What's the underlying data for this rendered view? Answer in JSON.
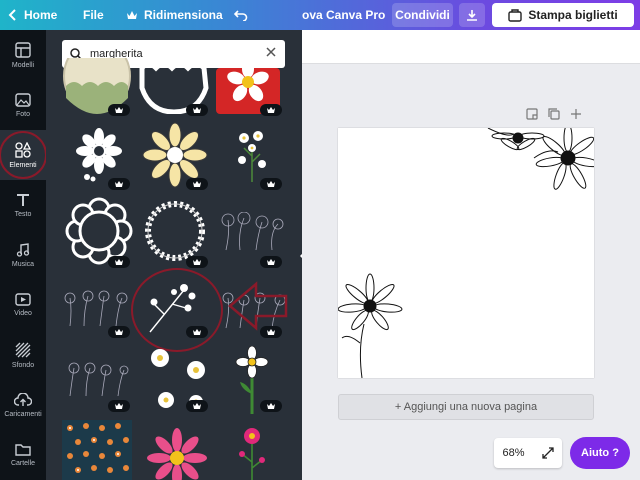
{
  "topbar": {
    "home_label": "Home",
    "file_label": "File",
    "resize_label": "Ridimensiona",
    "pro_label": "ova Canva Pro",
    "share_label": "Condividi",
    "print_label": "Stampa biglietti"
  },
  "rail": {
    "items": [
      {
        "label": "Modelli",
        "icon": "template-icon"
      },
      {
        "label": "Foto",
        "icon": "photo-icon"
      },
      {
        "label": "Elementi",
        "icon": "elements-icon"
      },
      {
        "label": "Testo",
        "icon": "text-icon"
      },
      {
        "label": "Musica",
        "icon": "music-icon"
      },
      {
        "label": "Video",
        "icon": "video-icon"
      },
      {
        "label": "Sfondo",
        "icon": "background-icon"
      },
      {
        "label": "Caricamenti",
        "icon": "upload-icon"
      },
      {
        "label": "Cartelle",
        "icon": "folder-icon"
      }
    ],
    "active": "Elementi"
  },
  "search": {
    "value": "margherita"
  },
  "workspace": {
    "add_page_label": "+ Aggiungi una nuova pagina",
    "zoom": "68%",
    "help_label": "Aiuto ?"
  },
  "colors": {
    "accent": "#7d2ae8",
    "panel_bg": "#293039",
    "rail_bg": "#0e1318",
    "annotation": "#8a1a2a"
  }
}
